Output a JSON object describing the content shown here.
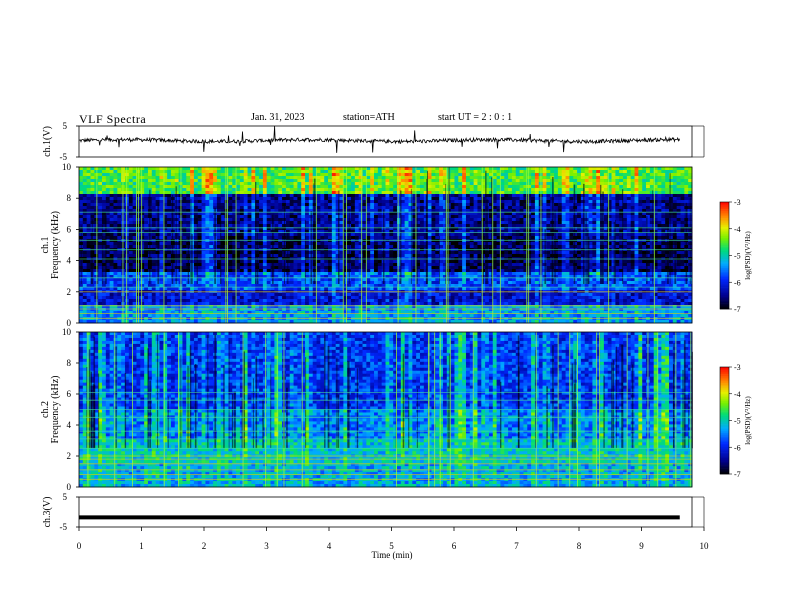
{
  "header": {
    "title": "VLF  Spectra",
    "date": "Jan. 31, 2023",
    "station": "station=ATH",
    "start_ut": "start  UT  =   2  : 0  : 1"
  },
  "chart_data": [
    {
      "type": "line",
      "ylabel": "ch.1(V)",
      "ylim": [
        -5,
        5
      ],
      "yticks": [
        "5",
        "-5"
      ],
      "xlim": [
        0,
        10
      ],
      "description_values": "noisy trace near 0.5 V with spikes"
    },
    {
      "type": "heatmap",
      "ylabel": "ch.1 Frequency (kHz)",
      "ylim": [
        0,
        10
      ],
      "yticks": [
        "0",
        "2",
        "4",
        "6",
        "8",
        "10"
      ],
      "xlim": [
        0,
        10
      ],
      "colorbar": {
        "label": "log(PSD)(V²/Hz)",
        "min": -7,
        "max": -3,
        "ticks": [
          "-3",
          "-4",
          "-5",
          "-6",
          "-7"
        ]
      }
    },
    {
      "type": "heatmap",
      "ylabel": "ch.2 Frequency (kHz)",
      "ylim": [
        0,
        10
      ],
      "yticks": [
        "0",
        "2",
        "4",
        "6",
        "8",
        "10"
      ],
      "xlim": [
        0,
        10
      ],
      "colorbar": {
        "label": "log(PSD)(V²/Hz)",
        "min": -7,
        "max": -3,
        "ticks": [
          "-3",
          "-4",
          "-5",
          "-6",
          "-7"
        ]
      }
    },
    {
      "type": "line",
      "ylabel": "ch.3(V)",
      "ylim": [
        -5,
        5
      ],
      "yticks": [
        "5",
        "-5"
      ],
      "xlim": [
        0,
        10
      ],
      "xticks": [
        "0",
        "1",
        "2",
        "3",
        "4",
        "5",
        "6",
        "7",
        "8",
        "9",
        "10"
      ],
      "xlabel": "Time  (min)"
    }
  ],
  "colors": {
    "low": "#000080",
    "mid": "#00c000",
    "high": "#ff0000"
  }
}
